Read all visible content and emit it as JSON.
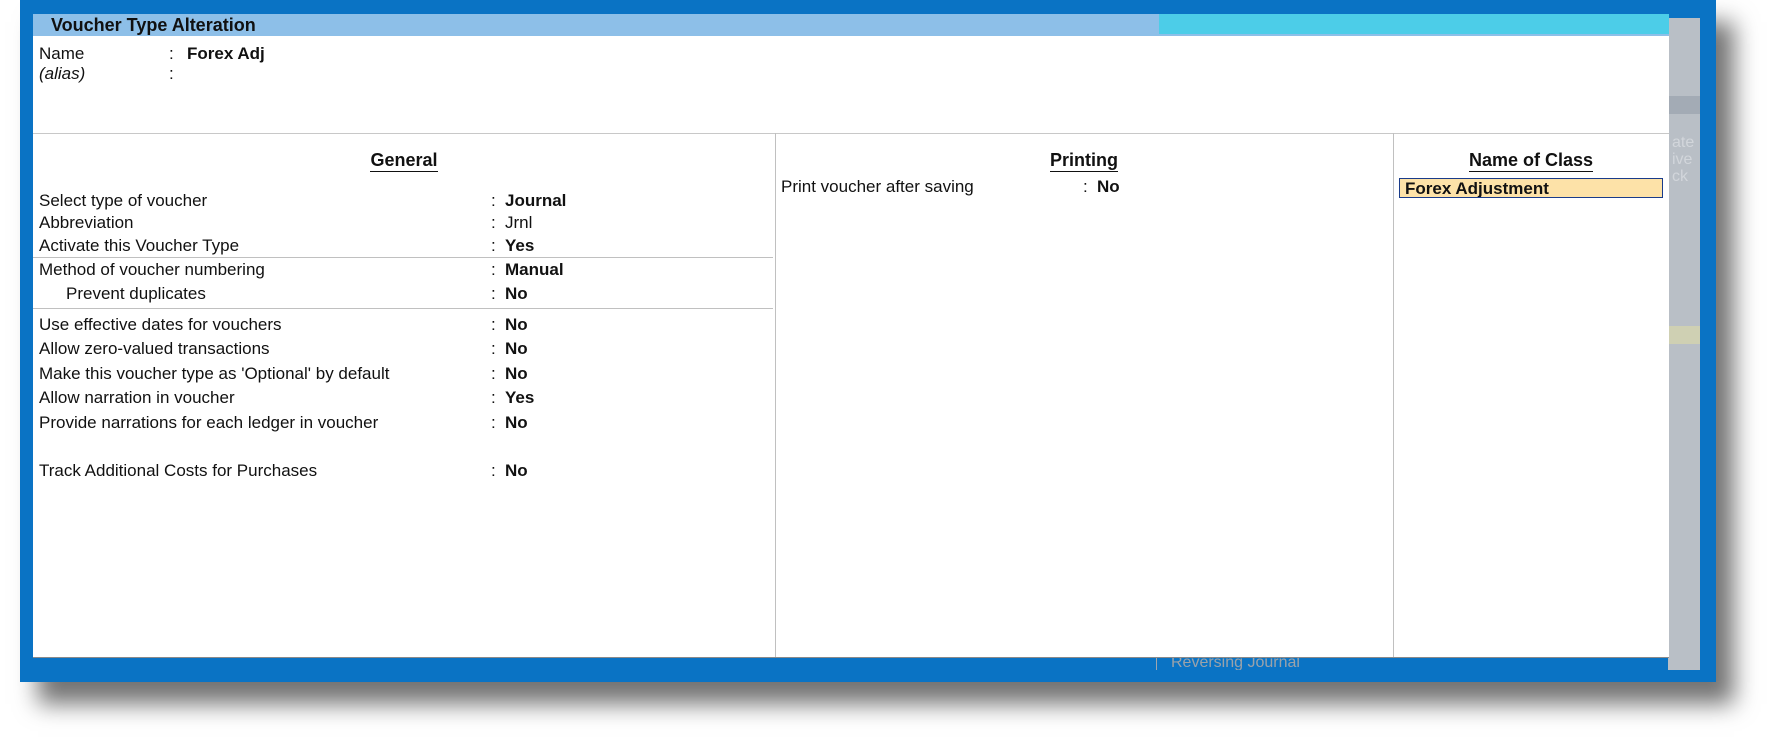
{
  "window": {
    "title": "Voucher Type Alteration"
  },
  "header": {
    "name_label": "Name",
    "name_value": "Forex Adj",
    "alias_label": "(alias)",
    "colon": ":"
  },
  "general": {
    "heading": "General",
    "rows": [
      {
        "label": "Select type of voucher",
        "value": "Journal"
      },
      {
        "label": "Abbreviation",
        "value": "Jrnl"
      },
      {
        "label": "Activate this Voucher Type",
        "value": "Yes"
      },
      {
        "label": "Method of voucher numbering",
        "value": "Manual"
      },
      {
        "label": "Prevent duplicates",
        "value": "No"
      },
      {
        "label": "Use effective dates for vouchers",
        "value": "No"
      },
      {
        "label": "Allow zero-valued transactions",
        "value": "No"
      },
      {
        "label": "Make this voucher type as 'Optional' by default",
        "value": "No"
      },
      {
        "label": "Allow narration in voucher",
        "value": "Yes"
      },
      {
        "label": "Provide narrations for each ledger in voucher",
        "value": "No"
      },
      {
        "label": "Track Additional Costs for Purchases",
        "value": "No"
      }
    ]
  },
  "printing": {
    "heading": "Printing",
    "rows": [
      {
        "label": "Print voucher after saving",
        "value": "No"
      }
    ]
  },
  "class_section": {
    "heading": "Name of Class",
    "value": "Forex Adjustment"
  },
  "background_window": {
    "fragments": [
      "ate",
      "ive",
      "ck"
    ],
    "bottom_text": "Reversing Journal"
  },
  "colors": {
    "frame": "#0a73c4",
    "titlebar": "#8dbfe8",
    "titlebar_accent": "#4ccde8",
    "highlight_field": "#fde2a8"
  }
}
